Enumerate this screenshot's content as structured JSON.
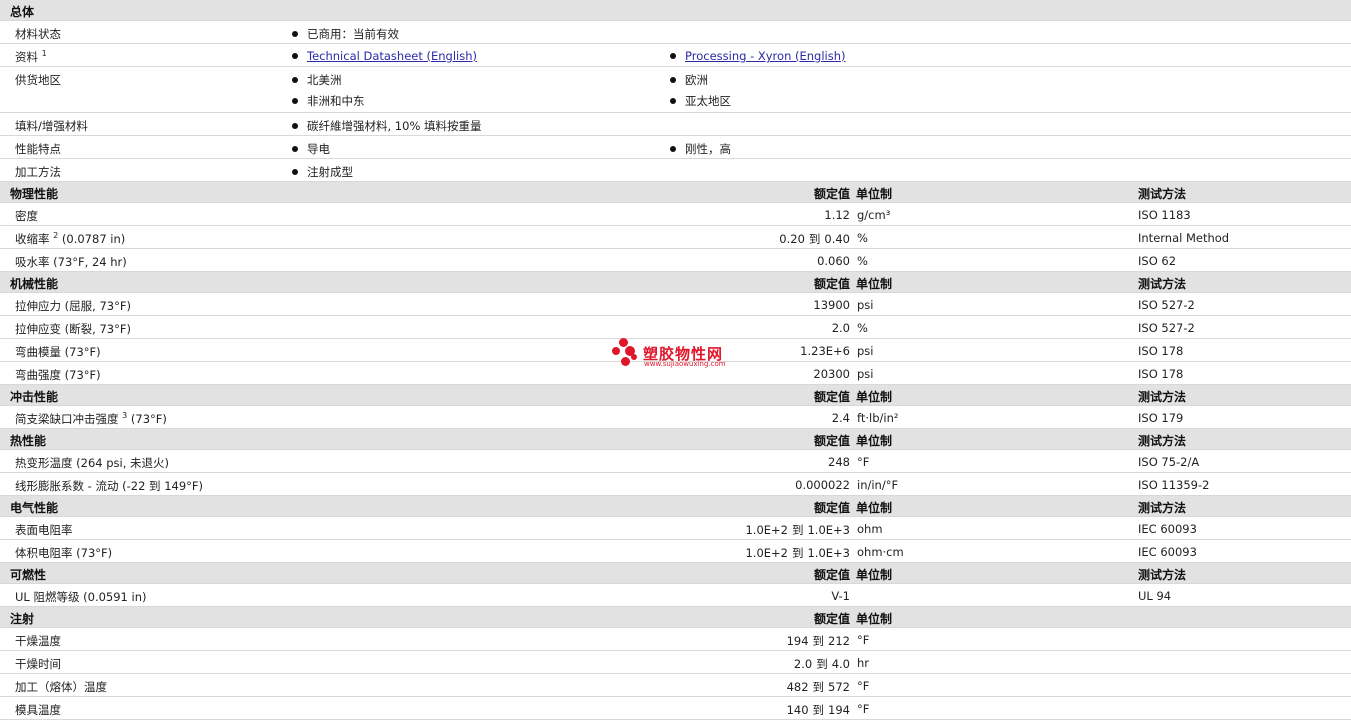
{
  "general": {
    "title": "总体",
    "rows": [
      {
        "label": "材料状态",
        "col1": [
          "已商用：当前有效"
        ],
        "col2": []
      },
      {
        "label": "资料",
        "sup": "1",
        "col1": [
          "Technical Datasheet (English)"
        ],
        "col2": [
          "Processing - Xyron (English)"
        ]
      },
      {
        "label": "供货地区",
        "col1": [
          "北美洲",
          "非洲和中东"
        ],
        "col2": [
          "欧洲",
          "亚太地区"
        ]
      },
      {
        "label": "填料/增强材料",
        "col1": [
          "碳纤維增强材料, 10% 填料按重量"
        ],
        "col2": []
      },
      {
        "label": "性能特点",
        "col1": [
          "导电"
        ],
        "col2": [
          "刚性，高"
        ]
      },
      {
        "label": "加工方法",
        "col1": [
          "注射成型"
        ],
        "col2": []
      }
    ]
  },
  "headers": {
    "value": "额定值",
    "unit": "单位制",
    "test": "测试方法"
  },
  "to_word": "到",
  "sections": [
    {
      "title": "物理性能",
      "rows": [
        {
          "label": "密度",
          "sup": "",
          "cond": "",
          "v1": "1.12",
          "v2": "",
          "unit": "g/cm³",
          "test": "ISO 1183"
        },
        {
          "label": "收缩率",
          "sup": "2",
          "cond": "(0.0787 in)",
          "v1": "0.20",
          "v2": "0.40",
          "unit": "%",
          "test": "Internal Method"
        },
        {
          "label": "吸水率",
          "sup": "",
          "cond": "(73°F, 24 hr)",
          "v1": "0.060",
          "v2": "",
          "unit": "%",
          "test": "ISO 62"
        }
      ]
    },
    {
      "title": "机械性能",
      "rows": [
        {
          "label": "拉伸应力",
          "sup": "",
          "cond": "(屈服, 73°F)",
          "v1": "13900",
          "v2": "",
          "unit": "psi",
          "test": "ISO 527-2"
        },
        {
          "label": "拉伸应变",
          "sup": "",
          "cond": "(断裂, 73°F)",
          "v1": "2.0",
          "v2": "",
          "unit": "%",
          "test": "ISO 527-2"
        },
        {
          "label": "弯曲模量",
          "sup": "",
          "cond": "(73°F)",
          "v1": "1.23E+6",
          "v2": "",
          "unit": "psi",
          "test": "ISO 178"
        },
        {
          "label": "弯曲强度",
          "sup": "",
          "cond": "(73°F)",
          "v1": "20300",
          "v2": "",
          "unit": "psi",
          "test": "ISO 178"
        }
      ]
    },
    {
      "title": "冲击性能",
      "rows": [
        {
          "label": "简支梁缺口冲击强度",
          "sup": "3",
          "cond": "(73°F)",
          "v1": "2.4",
          "v2": "",
          "unit": "ft·lb/in²",
          "test": "ISO 179"
        }
      ]
    },
    {
      "title": "热性能",
      "rows": [
        {
          "label": "热变形温度",
          "sup": "",
          "cond": "(264 psi, 未退火)",
          "v1": "248",
          "v2": "",
          "unit": "°F",
          "test": "ISO 75-2/A"
        },
        {
          "label": "线形膨胀系数 - 流动",
          "sup": "",
          "cond": "(-22 到 149°F)",
          "v1": "0.000022",
          "v2": "",
          "unit": "in/in/°F",
          "test": "ISO 11359-2"
        }
      ]
    },
    {
      "title": "电气性能",
      "rows": [
        {
          "label": "表面电阻率",
          "sup": "",
          "cond": "",
          "v1": "1.0E+2",
          "v2": "1.0E+3",
          "unit": "ohm",
          "test": "IEC 60093"
        },
        {
          "label": "体积电阻率",
          "sup": "",
          "cond": "(73°F)",
          "v1": "1.0E+2",
          "v2": "1.0E+3",
          "unit": "ohm·cm",
          "test": "IEC 60093"
        }
      ]
    },
    {
      "title": "可燃性",
      "rows": [
        {
          "label": "UL 阻燃等级",
          "sup": "",
          "cond": "(0.0591 in)",
          "v1": "V-1",
          "v2": "",
          "unit": "",
          "test": "UL 94"
        }
      ]
    },
    {
      "title": "注射",
      "noTest": true,
      "rows": [
        {
          "label": "干燥温度",
          "sup": "",
          "cond": "",
          "v1": "194",
          "v2": "212",
          "unit": "°F",
          "test": ""
        },
        {
          "label": "干燥时间",
          "sup": "",
          "cond": "",
          "v1": "2.0",
          "v2": "4.0",
          "unit": "hr",
          "test": ""
        },
        {
          "label": "加工（熔体）温度",
          "sup": "",
          "cond": "",
          "v1": "482",
          "v2": "572",
          "unit": "°F",
          "test": ""
        },
        {
          "label": "模具温度",
          "sup": "",
          "cond": "",
          "v1": "140",
          "v2": "194",
          "unit": "°F",
          "test": ""
        }
      ]
    }
  ],
  "watermark": {
    "name": "塑胶物性网",
    "url": "www.sujiaowuxing.com",
    "color": "#e0162b"
  }
}
